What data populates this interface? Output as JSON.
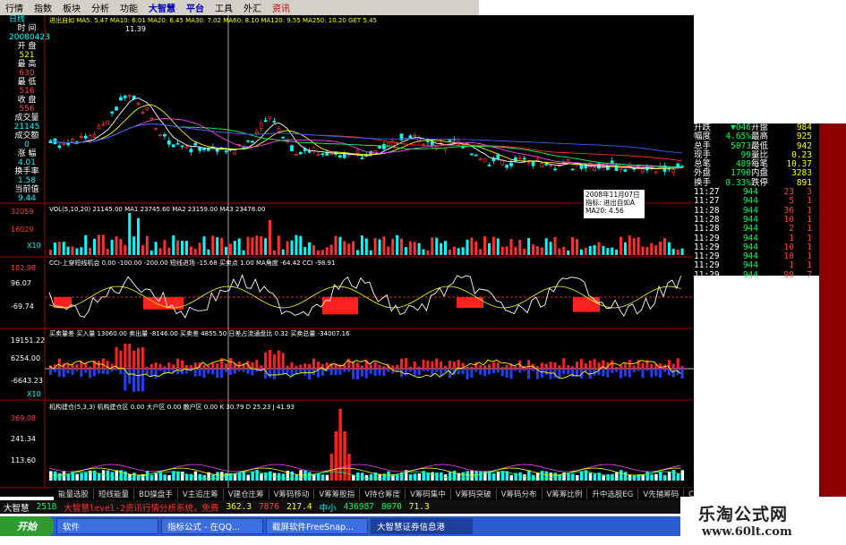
{
  "menu": [
    {
      "label": "行情",
      "style": ""
    },
    {
      "label": "指数",
      "style": ""
    },
    {
      "label": "板块",
      "style": ""
    },
    {
      "label": "分析",
      "style": ""
    },
    {
      "label": "功能",
      "style": ""
    },
    {
      "label": "大智慧",
      "style": "hl"
    },
    {
      "label": "平台",
      "style": "hl"
    },
    {
      "label": "工具",
      "style": ""
    },
    {
      "label": "外汇",
      "style": ""
    },
    {
      "label": "资讯",
      "style": "red"
    }
  ],
  "left_info": {
    "period": "日线",
    "labels": [
      "时 间",
      "20080423",
      "开 盘",
      "521",
      "最 高",
      "630",
      "最 低",
      "516",
      "收 盘",
      "556",
      "成交量",
      "21145",
      "成交额",
      "0",
      "涨 幅",
      "4.01",
      "换手率",
      "1.58",
      "当前值",
      "9.44"
    ]
  },
  "price_panel": {
    "legend": "进出自如 MA5: 5.47  MA10: 6.01  MA20: 6.45  MA30: 7.02  MA60: 8.10  MA120: 9.55  MA250: 10.20  GET 5.45",
    "peak_label": "11.39",
    "tooltip": [
      "2008年11月07日",
      "指标: 进出自如A",
      "MA20: 4.56"
    ]
  },
  "vol_panel": {
    "legend": "VOL(5,10,20)  21145.00  MA1 23745.60  MA2 23159.00  MA3 23478.00",
    "y": [
      "32059",
      "16029"
    ],
    "unit": "X10"
  },
  "cci_panel": {
    "legend": "CCI-上穿短线机会 0.00  -100.00  -200.00  短线进场  -15.68  买卖点  1.00  MA角度  -64.42  CCI  -98.91",
    "y": [
      "182.98",
      "96.07",
      "-69.74"
    ]
  },
  "buy_panel": {
    "legend": "买卖量差  买入量 13060.00  卖出量 -8146.00  买卖差 4855.50  日差占流通盘比 0.32  买卖总量 -34007.16",
    "y": [
      "19151.22",
      "6254.00",
      "-6643.23"
    ],
    "unit": "X10"
  },
  "jg_panel": {
    "legend": "机构建仓(5,3,3)  机构建仓区 0.00  大户区 0.00  散户区 0.00  K 30.79  D 25.23  J 41.93",
    "y": [
      "369.08",
      "241.34",
      "113.60"
    ]
  },
  "right_quote": {
    "rows": [
      [
        "升跌",
        "▼046",
        "开盘",
        "984"
      ],
      [
        "幅度",
        "4.65%",
        "最高",
        "925"
      ],
      [
        "总手",
        "5073",
        "最低",
        "942"
      ],
      [
        "现手",
        "99",
        "量比",
        "0.23"
      ],
      [
        "总笔",
        "489",
        "每笔",
        "10.37"
      ],
      [
        "外盘",
        "1790",
        "内盘",
        "3283"
      ],
      [
        "换手",
        "0.33%",
        "跌停",
        "891"
      ]
    ],
    "ticks": [
      [
        "11:27",
        "944",
        "23",
        "3"
      ],
      [
        "11:27",
        "944",
        "5",
        "1"
      ],
      [
        "11:28",
        "944",
        "36",
        "1"
      ],
      [
        "11:28",
        "944",
        "10",
        "1"
      ],
      [
        "11:28",
        "944",
        "2",
        "1"
      ],
      [
        "11:29",
        "944",
        "1",
        "1"
      ],
      [
        "11:29",
        "944",
        "10",
        "1"
      ],
      [
        "11:29",
        "944",
        "10",
        "1"
      ],
      [
        "11:29",
        "944",
        "1",
        "1"
      ],
      [
        "11:29",
        "944",
        "99",
        "7"
      ]
    ]
  },
  "bottom_tabs": [
    "能量选股",
    "短线能量",
    "BD操盘手",
    "V主追庄筹",
    "V建仓庄筹",
    "V筹码移动",
    "V筹筹股指",
    "V持仓筹度",
    "V筹码集中",
    "V筹码突破",
    "V筹码分布",
    "V筹筹比例",
    "升中选股EG",
    "V先捕筹码",
    "CCI双重线"
  ],
  "status": {
    "items": [
      "大智慧",
      "2518",
      "362.3",
      "7876",
      "217.4",
      "中小",
      "436987",
      "8070",
      "71.3"
    ],
    "marquee": "大智慧level-2资讯行情分析系统，免费"
  },
  "taskbar": {
    "start": "开始",
    "tasks": [
      "软件",
      "指标公式 - 在QQ...",
      "截屏软件FreeSnap...",
      "大智慧证券信息港"
    ]
  },
  "brand": {
    "name": "乐淘公式网",
    "url": "www.60lt.com"
  },
  "colors": {
    "up": "#ff3030",
    "down": "#00ffff",
    "ma_yellow": "#ffff00",
    "ma_white": "#ffffff",
    "ma_green": "#00ff60",
    "ma_magenta": "#ff40ff"
  }
}
